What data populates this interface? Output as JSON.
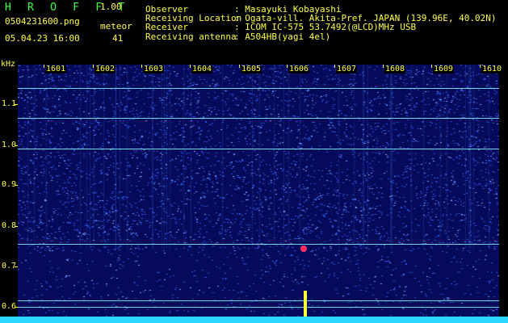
{
  "header": {
    "app_title": "H R O F F T",
    "version": "1.00",
    "filename": "0504231600.png",
    "datetime": "05.04.23 16:00",
    "meteor_label": "meteor",
    "meteor_count": "41"
  },
  "info": [
    {
      "label": "Observer",
      "value": ": Masayuki Kobayashi"
    },
    {
      "label": "Receiving Location",
      "value": ": Ogata-vill. Akita-Pref. JAPAN (139.96E, 40.02N)"
    },
    {
      "label": "Receiver",
      "value": ": ICOM IC-575 53.7492(@LCD)MHz USB"
    },
    {
      "label": "Receiving antenna",
      "value": ": A504HB(yagi 4el)"
    }
  ],
  "spectrogram": {
    "y_unit": "kHz",
    "y_ticks": [
      "1.1",
      "1.0",
      "0.9",
      "0.8",
      "0.7",
      "0.6"
    ],
    "x_ticks": [
      "1601",
      "1602",
      "1603",
      "1604",
      "1605",
      "1606",
      "1607",
      "1608",
      "1609",
      "1610"
    ],
    "colors": {
      "background": "#050a5a",
      "noise": "#3a6cff",
      "hline": "#7ffcff",
      "meteor": "#ffff3a"
    }
  }
}
